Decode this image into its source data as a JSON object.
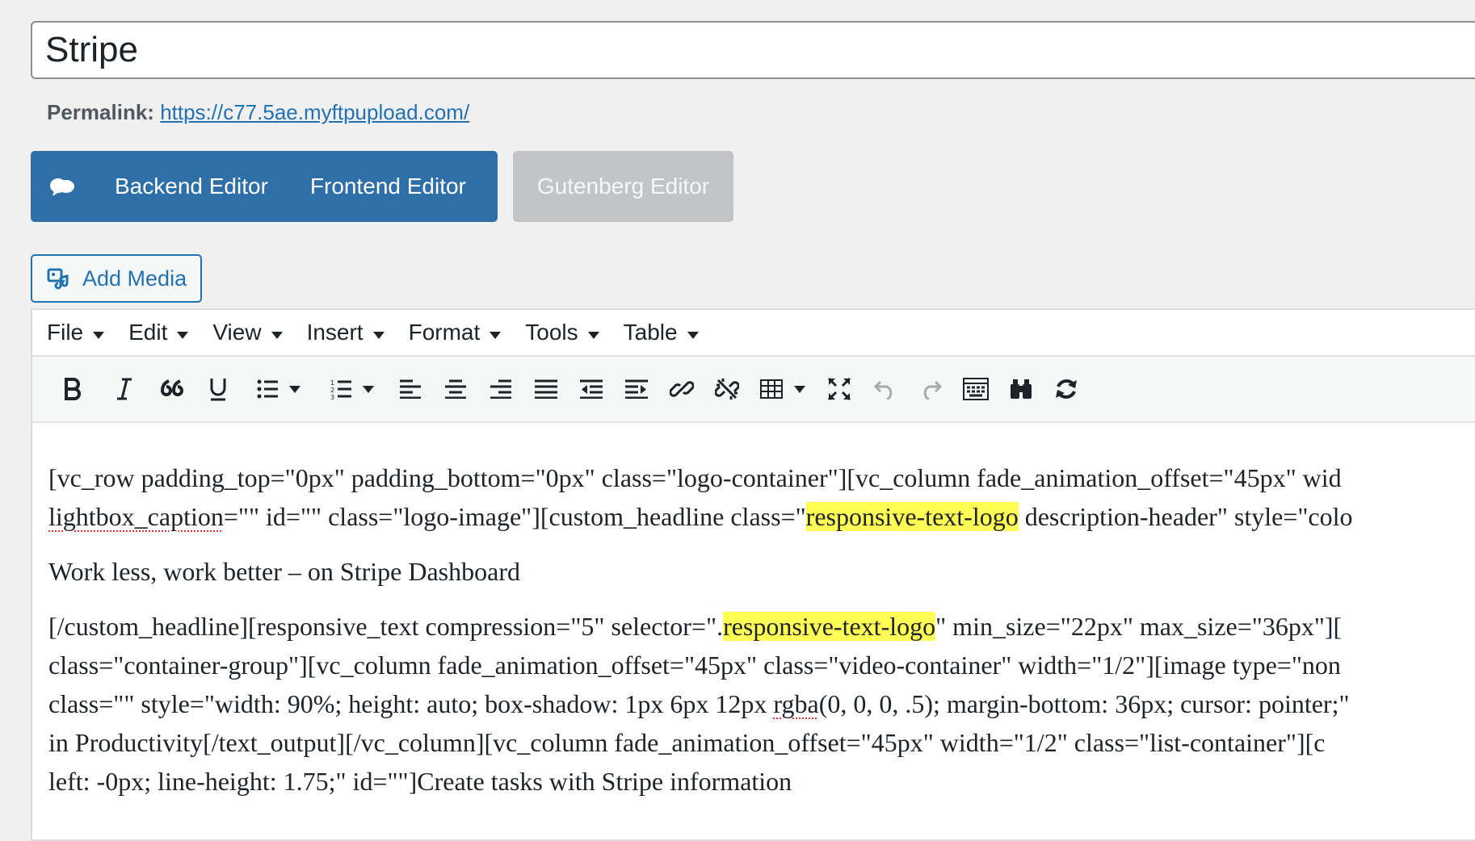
{
  "post_title": "Stripe",
  "permalink": {
    "label": "Permalink:",
    "url": "https://c77.5ae.myftpupload.com/"
  },
  "builder": {
    "backend_label": "Backend Editor",
    "frontend_label": "Frontend Editor",
    "gutenberg_label": "Gutenberg Editor"
  },
  "add_media_label": "Add Media",
  "menubar": [
    "File",
    "Edit",
    "View",
    "Insert",
    "Format",
    "Tools",
    "Table"
  ],
  "toolbar_icons": [
    "bold-icon",
    "italic-icon",
    "blockquote-icon",
    "underline-icon",
    "bullet-list-icon",
    "numbered-list-icon",
    "align-left-icon",
    "align-center-icon",
    "align-right-icon",
    "align-justify-icon",
    "outdent-icon",
    "indent-icon",
    "link-icon",
    "unlink-icon",
    "table-icon",
    "fullscreen-icon",
    "undo-icon",
    "redo-icon",
    "toolbar-toggle-icon",
    "find-replace-icon",
    "refresh-icon"
  ],
  "content": {
    "p1_l1": "[vc_row padding_top=\"0px\" padding_bottom=\"0px\" class=\"logo-container\"][vc_column fade_animation_offset=\"45px\" wid",
    "p1_l2_a": "lightbox_caption",
    "p1_l2_b": "=\"\" id=\"\" class=\"logo-image\"][custom_headline class=\"",
    "p1_l2_hl": "responsive-text-logo",
    "p1_l2_c": " description-header\" style=\"colo",
    "p2": "Work less, work better – on Stripe Dashboard",
    "p3_l1_a": "[/custom_headline][responsive_text compression=\"5\" selector=\".",
    "p3_l1_hl": "responsive-text-logo",
    "p3_l1_b": "\" min_size=\"22px\" max_size=\"36px\"][",
    "p3_l2": "class=\"container-group\"][vc_column fade_animation_offset=\"45px\" class=\"video-container\" width=\"1/2\"][image type=\"non",
    "p3_l3_a": "class=\"\" style=\"width: 90%; height: auto; box-shadow: 1px 6px 12px ",
    "p3_l3_sp": "rgba",
    "p3_l3_b": "(0, 0, 0, .5); margin-bottom: 36px; cursor: pointer;\"",
    "p3_l4": "in Productivity[/text_output][/vc_column][vc_column fade_animation_offset=\"45px\" width=\"1/2\" class=\"list-container\"][c",
    "p3_l5": "left: -0px; line-height: 1.75;\" id=\"\"]Create tasks with Stripe information"
  }
}
